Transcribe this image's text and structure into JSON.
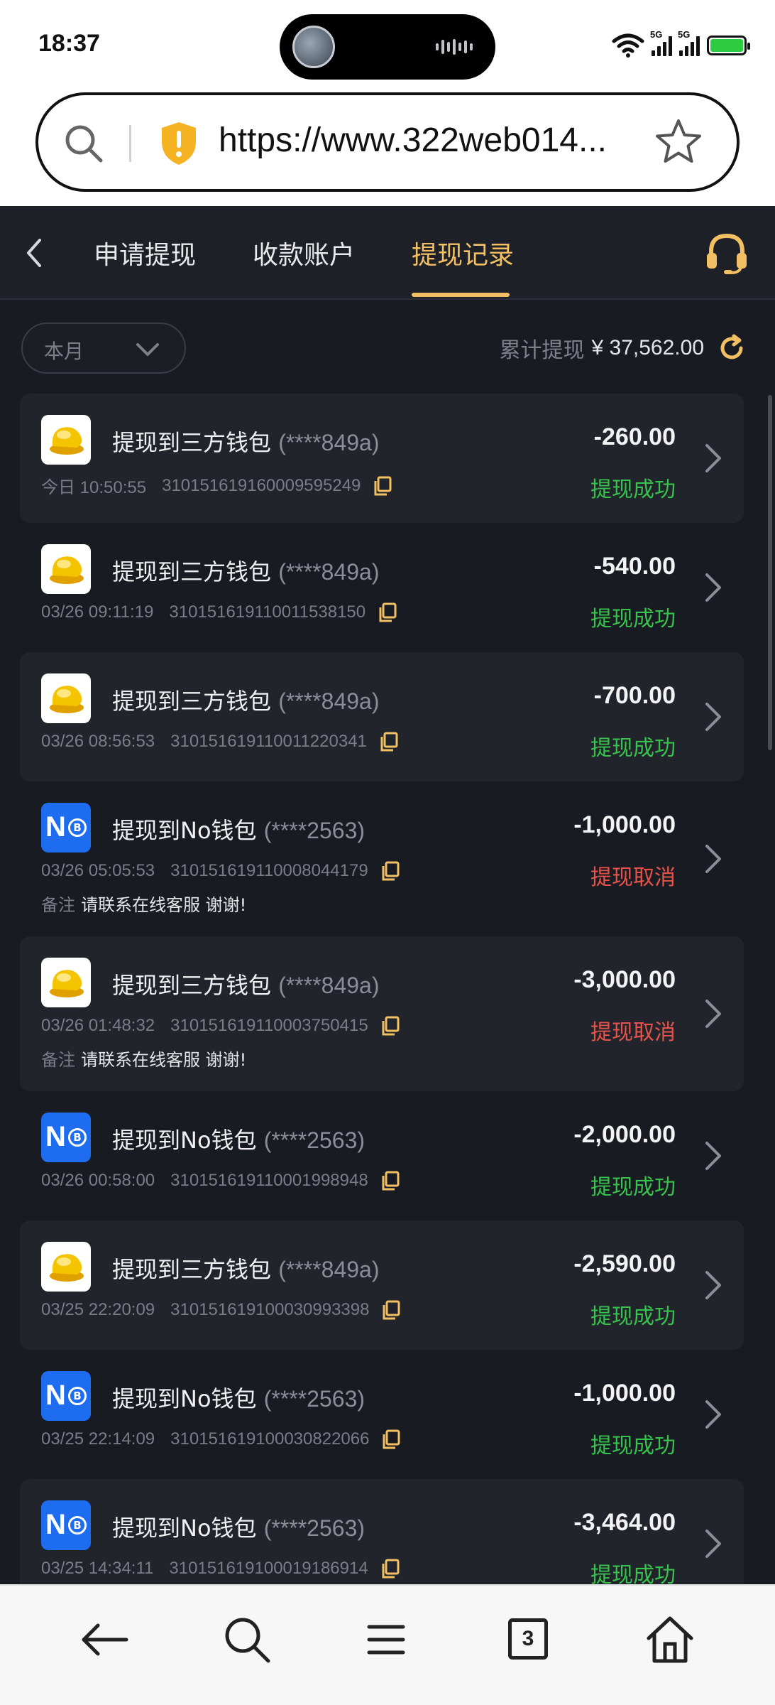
{
  "status_bar": {
    "time": "18:37",
    "network_1": "5G",
    "network_2": "5G",
    "icons": [
      "wifi-icon",
      "signal-icon",
      "battery-charging-icon"
    ]
  },
  "browser": {
    "url": "https://www.322web014...",
    "icons": [
      "search-icon",
      "shield-warning-icon",
      "star-icon"
    ]
  },
  "header": {
    "tabs": [
      {
        "label": "申请提现"
      },
      {
        "label": "收款账户"
      },
      {
        "label": "提现记录"
      }
    ],
    "active_tab": 2,
    "accent_color": "#f2c063"
  },
  "filter": {
    "month": "本月",
    "total_label": "累计提现",
    "total_value": "¥ 37,562.00"
  },
  "records": [
    {
      "icon": "gold-wallet-icon",
      "title": "提现到三方钱包",
      "account": "(****849a)",
      "time": "今日 10:50:55",
      "order": "310151619160009595249",
      "amount": "-260.00",
      "status": "提现成功",
      "status_type": "ok",
      "note": ""
    },
    {
      "icon": "gold-wallet-icon",
      "title": "提现到三方钱包",
      "account": "(****849a)",
      "time": "03/26 09:11:19",
      "order": "310151619110011538150",
      "amount": "-540.00",
      "status": "提现成功",
      "status_type": "ok",
      "note": ""
    },
    {
      "icon": "gold-wallet-icon",
      "title": "提现到三方钱包",
      "account": "(****849a)",
      "time": "03/26 08:56:53",
      "order": "310151619110011220341",
      "amount": "-700.00",
      "status": "提现成功",
      "status_type": "ok",
      "note": ""
    },
    {
      "icon": "no-wallet-icon",
      "title": "提现到No钱包",
      "account": "(****2563)",
      "time": "03/26 05:05:53",
      "order": "310151619110008044179",
      "amount": "-1,000.00",
      "status": "提现取消",
      "status_type": "cancel",
      "note_label": "备注",
      "note": "请联系在线客服 谢谢!"
    },
    {
      "icon": "gold-wallet-icon",
      "title": "提现到三方钱包",
      "account": "(****849a)",
      "time": "03/26 01:48:32",
      "order": "310151619110003750415",
      "amount": "-3,000.00",
      "status": "提现取消",
      "status_type": "cancel",
      "note_label": "备注",
      "note": "请联系在线客服 谢谢!"
    },
    {
      "icon": "no-wallet-icon",
      "title": "提现到No钱包",
      "account": "(****2563)",
      "time": "03/26 00:58:00",
      "order": "310151619110001998948",
      "amount": "-2,000.00",
      "status": "提现成功",
      "status_type": "ok",
      "note": ""
    },
    {
      "icon": "gold-wallet-icon",
      "title": "提现到三方钱包",
      "account": "(****849a)",
      "time": "03/25 22:20:09",
      "order": "310151619100030993398",
      "amount": "-2,590.00",
      "status": "提现成功",
      "status_type": "ok",
      "note": ""
    },
    {
      "icon": "no-wallet-icon",
      "title": "提现到No钱包",
      "account": "(****2563)",
      "time": "03/25 22:14:09",
      "order": "310151619100030822066",
      "amount": "-1,000.00",
      "status": "提现成功",
      "status_type": "ok",
      "note": ""
    },
    {
      "icon": "no-wallet-icon",
      "title": "提现到No钱包",
      "account": "(****2563)",
      "time": "03/25 14:34:11",
      "order": "310151619100019186914",
      "amount": "-3,464.00",
      "status": "提现成功",
      "status_type": "ok",
      "note": ""
    }
  ],
  "no_logo_text": "N",
  "no_logo_coin": "B",
  "bottom_bar": {
    "tab_count": "3",
    "icons": [
      "back-arrow-icon",
      "search-icon",
      "menu-icon",
      "tabs-icon",
      "home-icon"
    ]
  },
  "colors": {
    "success": "#36c24c",
    "cancel": "#e4544b",
    "background": "#191b22"
  }
}
